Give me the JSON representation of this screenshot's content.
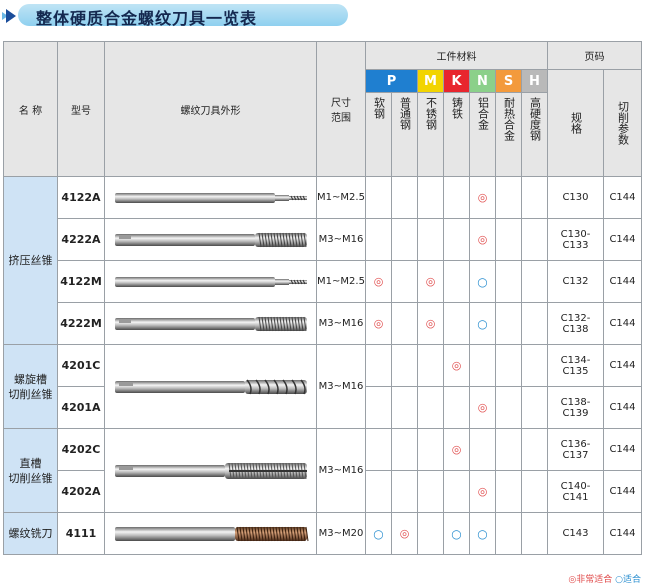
{
  "title": "整体硬质合金螺纹刀具一览表",
  "headers": {
    "name": "名 称",
    "model": "型号",
    "shape": "螺纹刀具外形",
    "size": "尺寸\n范围",
    "material_group": "工件材料",
    "page_group": "页码",
    "materials": [
      {
        "letter": "P",
        "color": "#1f7fd0",
        "label": "软钢"
      },
      {
        "letter": "",
        "color": "#1f7fd0",
        "label": "普通钢"
      },
      {
        "letter": "M",
        "color": "#f2d400",
        "label": "不锈钢"
      },
      {
        "letter": "K",
        "color": "#e8262e",
        "label": "铸铁"
      },
      {
        "letter": "N",
        "color": "#8bd08a",
        "label": "铝合金"
      },
      {
        "letter": "S",
        "color": "#f39a3c",
        "label": "耐热合金"
      },
      {
        "letter": "H",
        "color": "#b9b9b9",
        "label": "高硬度钢"
      }
    ],
    "spec": "规格",
    "cut_param": "切削参数"
  },
  "groups": [
    {
      "name": "挤压丝锥",
      "rows": [
        {
          "model": "4122A",
          "size": "M1~M2.5",
          "marks": [
            "",
            "",
            "",
            "",
            "◎",
            "",
            ""
          ],
          "spec": "C130",
          "param": "C144",
          "tool": "thin"
        },
        {
          "model": "4222A",
          "size": "M3~M16",
          "marks": [
            "",
            "",
            "",
            "",
            "◎",
            "",
            ""
          ],
          "spec": "C130-C133",
          "param": "C144",
          "tool": "long"
        },
        {
          "model": "4122M",
          "size": "M1~M2.5",
          "marks": [
            "◎",
            "",
            "◎",
            "",
            "○",
            "",
            ""
          ],
          "spec": "C132",
          "param": "C144",
          "tool": "thin"
        },
        {
          "model": "4222M",
          "size": "M3~M16",
          "marks": [
            "◎",
            "",
            "◎",
            "",
            "○",
            "",
            ""
          ],
          "spec": "C132-C138",
          "param": "C144",
          "tool": "long"
        }
      ]
    },
    {
      "name": "螺旋槽\n切削丝锥",
      "size": "M3~M16",
      "rows": [
        {
          "model": "4201C",
          "marks": [
            "",
            "",
            "",
            "◎",
            "",
            "",
            ""
          ],
          "spec": "C134-C135",
          "param": "C144",
          "tool": "spiral"
        },
        {
          "model": "4201A",
          "marks": [
            "",
            "",
            "",
            "",
            "◎",
            "",
            ""
          ],
          "spec": "C138-C139",
          "param": "C144"
        }
      ]
    },
    {
      "name": "直槽\n切削丝锥",
      "size": "M3~M16",
      "rows": [
        {
          "model": "4202C",
          "marks": [
            "",
            "",
            "",
            "◎",
            "",
            "",
            ""
          ],
          "spec": "C136-C137",
          "param": "C144",
          "tool": "straight"
        },
        {
          "model": "4202A",
          "marks": [
            "",
            "",
            "",
            "",
            "◎",
            "",
            ""
          ],
          "spec": "C140-C141",
          "param": "C144"
        }
      ]
    },
    {
      "name": "螺纹铣刀",
      "rows": [
        {
          "model": "4111",
          "size": "M3~M20",
          "marks": [
            "○",
            "◎",
            "",
            "○",
            "○",
            "",
            ""
          ],
          "spec": "C143",
          "param": "C144",
          "tool": "mill"
        }
      ]
    }
  ],
  "legend": {
    "excellent": "◎非常适合",
    "suitable": "○适合"
  }
}
